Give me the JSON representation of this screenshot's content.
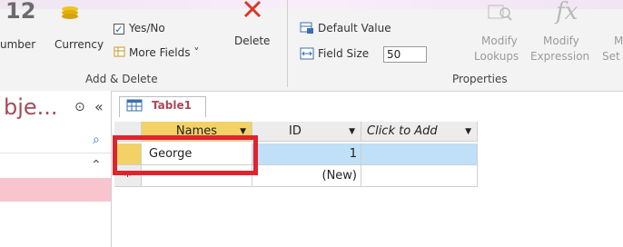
{
  "ribbon": {
    "partial_number_label": "umber",
    "currency_label": "Currency",
    "yes_no_label": "Yes/No",
    "more_fields_label": "More Fields",
    "delete_label": "Delete",
    "add_delete_group_label": "Add & Delete",
    "default_value_label": "Default Value",
    "field_size_label": "Field Size",
    "field_size_value": "50",
    "modify_lookups_label_1": "Modify",
    "modify_lookups_label_2": "Lookups",
    "modify_expression_label_1": "Modify",
    "modify_expression_label_2": "Expression",
    "partial_set_label_1": "M",
    "partial_set_label_2": "Set",
    "properties_group_label": "Properties",
    "big_number_fragment": "12",
    "fx_label": "fx"
  },
  "nav": {
    "title": "bje...",
    "menu_glyph": "⊙",
    "collapse_glyph": "«",
    "search_glyph": "⌕",
    "expand_glyph": "⌃"
  },
  "tab": {
    "label": "Table1"
  },
  "grid": {
    "columns": [
      "Names",
      "ID",
      "Click to Add"
    ],
    "rows": [
      {
        "names": "George",
        "id": "1"
      },
      {
        "new_marker": "*",
        "names": "",
        "id": "(New)"
      }
    ]
  },
  "colors": {
    "highlight": "#e0232d",
    "selected_row": "#bfe0f7",
    "selector": "#f2d266",
    "access_accent": "#a64b58"
  }
}
